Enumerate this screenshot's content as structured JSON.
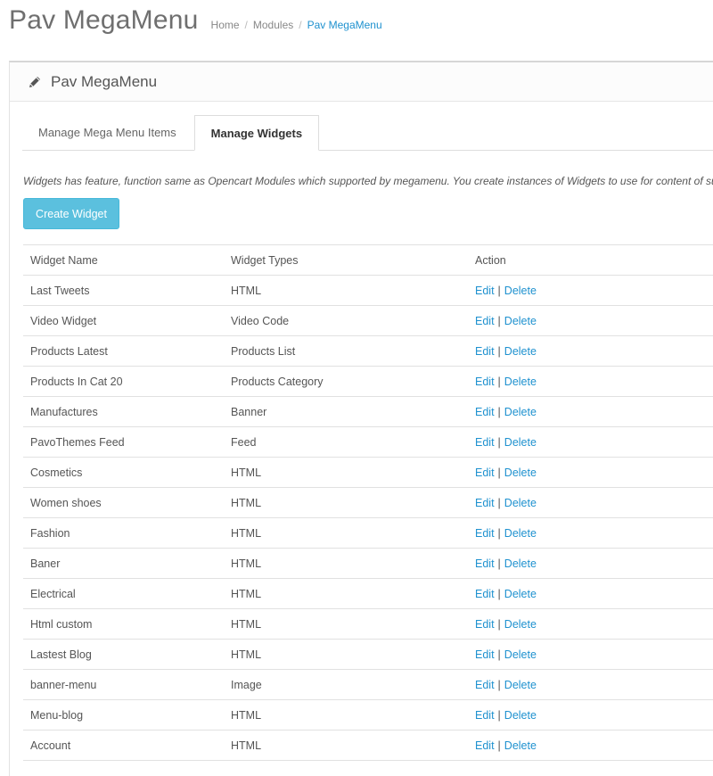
{
  "header": {
    "title": "Pav MegaMenu",
    "breadcrumb": [
      "Home",
      "Modules",
      "Pav MegaMenu"
    ]
  },
  "panel": {
    "title": "Pav MegaMenu",
    "icon": "pencil-icon"
  },
  "tabs": [
    {
      "label": "Manage Mega Menu Items",
      "active": false
    },
    {
      "label": "Manage Widgets",
      "active": true
    }
  ],
  "description": "Widgets has feature, function same as Opencart Modules which supported by megamenu. You create instances of Widgets to use for content of subl",
  "create_button": "Create Widget",
  "table": {
    "headers": [
      "Widget Name",
      "Widget Types",
      "Action"
    ],
    "edit_label": "Edit",
    "delete_label": "Delete",
    "separator": "|",
    "rows": [
      {
        "name": "Last Tweets",
        "type": "HTML"
      },
      {
        "name": "Video Widget",
        "type": "Video Code"
      },
      {
        "name": "Products Latest",
        "type": "Products List"
      },
      {
        "name": "Products In Cat 20",
        "type": "Products Category"
      },
      {
        "name": "Manufactures",
        "type": "Banner"
      },
      {
        "name": "PavoThemes Feed",
        "type": "Feed"
      },
      {
        "name": "Cosmetics",
        "type": "HTML"
      },
      {
        "name": "Women shoes",
        "type": "HTML"
      },
      {
        "name": "Fashion",
        "type": "HTML"
      },
      {
        "name": "Baner",
        "type": "HTML"
      },
      {
        "name": "Electrical",
        "type": "HTML"
      },
      {
        "name": "Html custom",
        "type": "HTML"
      },
      {
        "name": "Lastest Blog",
        "type": "HTML"
      },
      {
        "name": "banner-menu",
        "type": "Image"
      },
      {
        "name": "Menu-blog",
        "type": "HTML"
      },
      {
        "name": "Account",
        "type": "HTML"
      }
    ]
  },
  "colors": {
    "link": "#1e91cf",
    "button": "#5bc0de"
  }
}
